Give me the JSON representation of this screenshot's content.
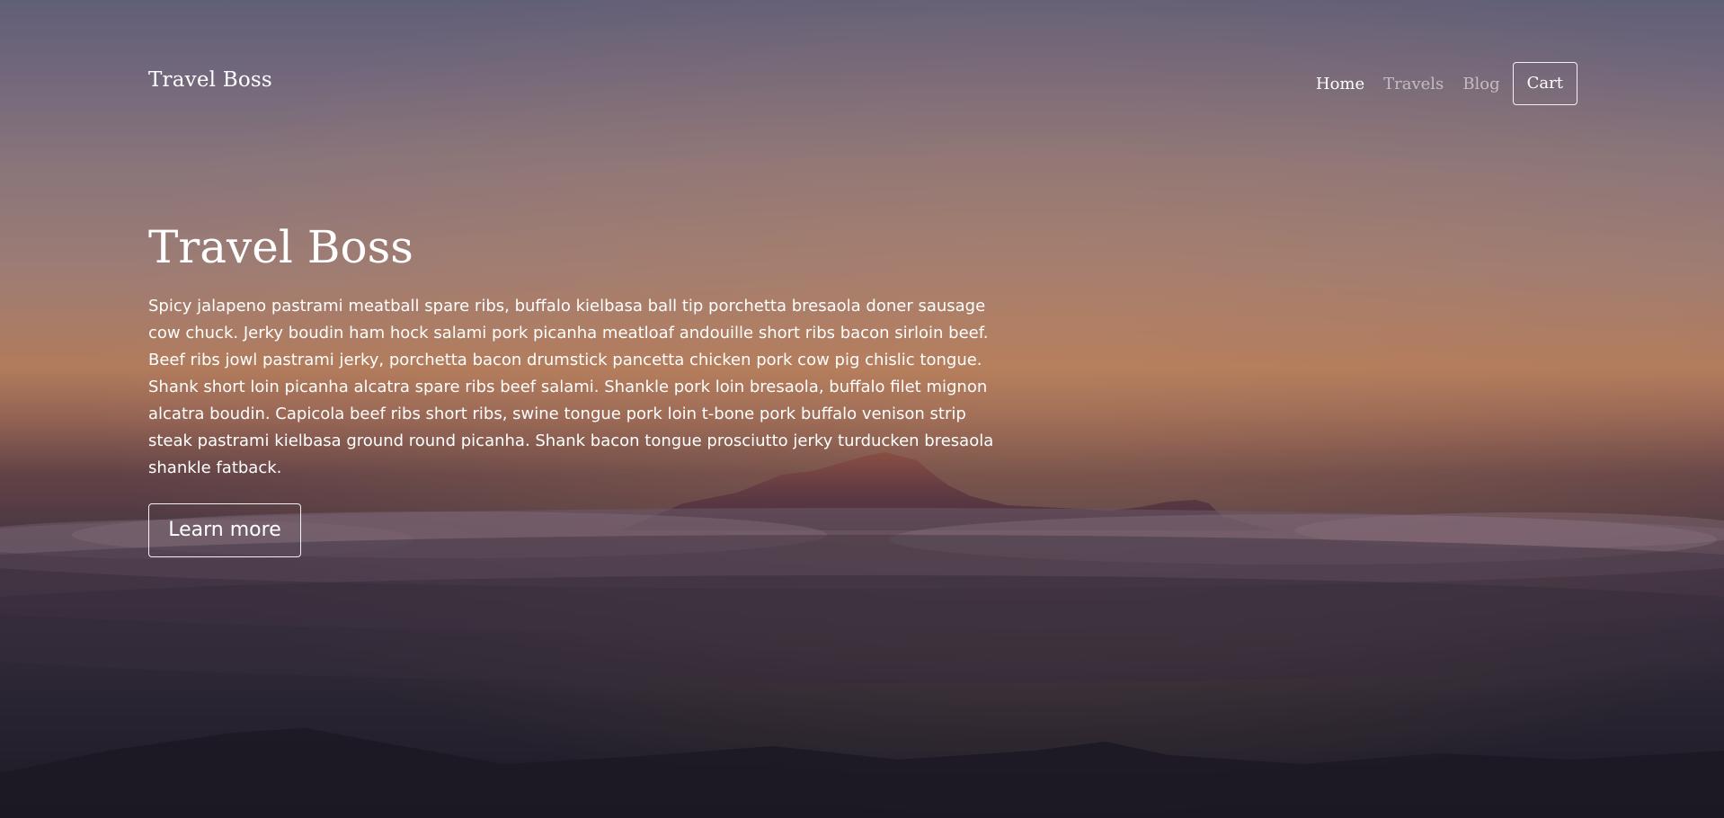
{
  "brand": "Travel Boss",
  "nav": {
    "home": "Home",
    "travels": "Travels",
    "blog": "Blog",
    "cart": "Cart"
  },
  "hero": {
    "title": "Travel Boss",
    "description": "Spicy jalapeno pastrami meatball spare ribs, buffalo kielbasa ball tip porchetta bresaola doner sausage cow chuck. Jerky boudin ham hock salami pork picanha meatloaf andouille short ribs bacon sirloin beef. Beef ribs jowl pastrami jerky, porchetta bacon drumstick pancetta chicken pork cow pig chislic tongue. Shank short loin picanha alcatra spare ribs beef salami. Shankle pork loin bresaola, buffalo filet mignon alcatra boudin. Capicola beef ribs short ribs, swine tongue pork loin t-bone pork buffalo venison strip steak pastrami kielbasa ground round picanha. Shank bacon tongue prosciutto jerky turducken bresaola shankle fatback.",
    "cta": "Learn more"
  }
}
